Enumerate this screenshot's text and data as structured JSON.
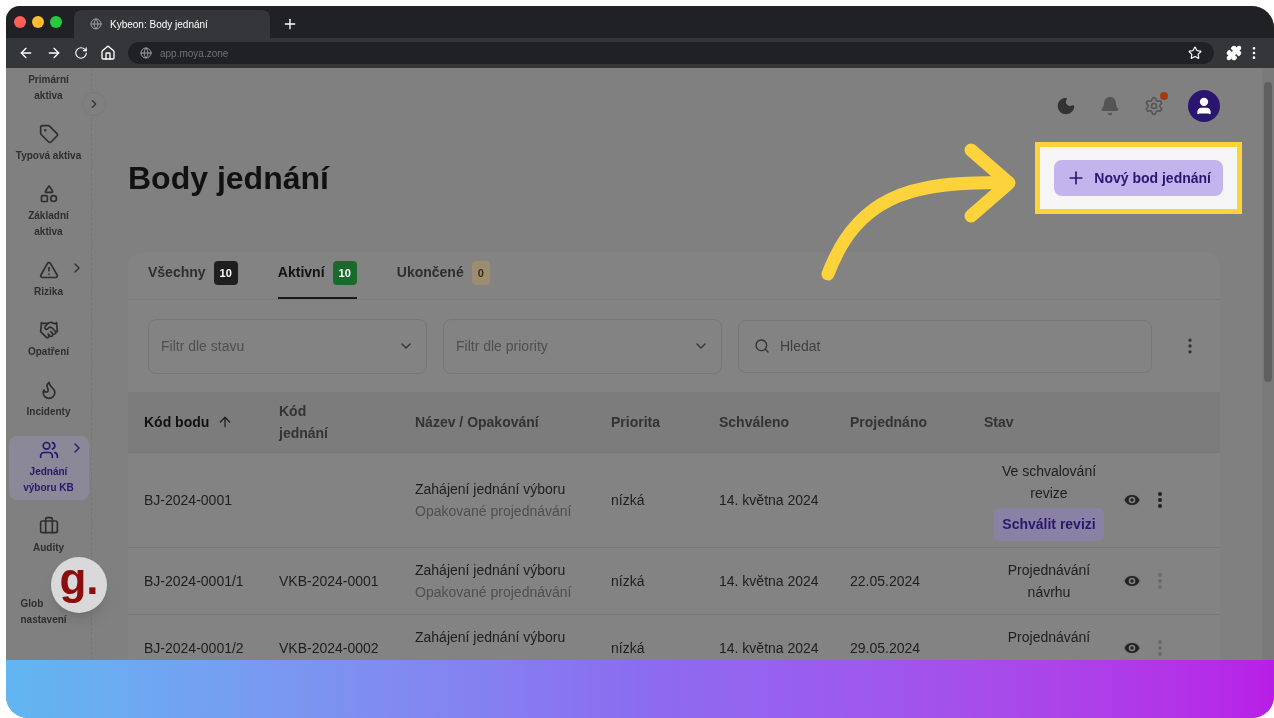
{
  "browser": {
    "tab_title": "Kybeon: Body jednání",
    "url": "app.moya.zone"
  },
  "sidebar": {
    "items": [
      {
        "kind": "none",
        "lines": [
          "Primární",
          "aktiva"
        ],
        "selected": false,
        "submenu": false
      },
      {
        "kind": "tag",
        "lines": [
          "Typová aktiva"
        ],
        "selected": false,
        "submenu": false
      },
      {
        "kind": "shapes",
        "lines": [
          "Základní",
          "aktiva"
        ],
        "selected": false,
        "submenu": false
      },
      {
        "kind": "warning",
        "lines": [
          "Rizika"
        ],
        "selected": false,
        "submenu": true
      },
      {
        "kind": "handshake",
        "lines": [
          "Opatření"
        ],
        "selected": false,
        "submenu": false
      },
      {
        "kind": "flame",
        "lines": [
          "Incidenty"
        ],
        "selected": false,
        "submenu": false
      },
      {
        "kind": "people",
        "lines": [
          "Jednání",
          "výboru KB"
        ],
        "selected": true,
        "submenu": true
      },
      {
        "kind": "briefcase",
        "lines": [
          "Audity"
        ],
        "selected": false,
        "submenu": false
      },
      {
        "kind": "none",
        "lines": [
          "Glob",
          "nastavení"
        ],
        "selected": false,
        "submenu": false
      }
    ]
  },
  "badge": {
    "text": "g."
  },
  "topbar": {
    "settings_notification": true
  },
  "page": {
    "title": "Body jednání",
    "new_button": "Nový bod jednání"
  },
  "tabs": [
    {
      "label": "Všechny",
      "count": "10",
      "color": "#1f1f1f",
      "selected": false
    },
    {
      "label": "Aktivní",
      "count": "10",
      "color": "#1a6a2c",
      "selected": true
    },
    {
      "label": "Ukončené",
      "count": "0",
      "color": "#9c8c70",
      "selected": false
    }
  ],
  "filters": [
    {
      "placeholder": "Filtr dle stavu"
    },
    {
      "placeholder": "Filtr dle priority"
    }
  ],
  "search": {
    "placeholder": "Hledat"
  },
  "table": {
    "columns": [
      {
        "label": "Kód bodu",
        "sorted": true
      },
      {
        "label": "Kód jednání",
        "sorted": false
      },
      {
        "label": "Název / Opakování",
        "sorted": false
      },
      {
        "label": "Priorita",
        "sorted": false
      },
      {
        "label": "Schváleno",
        "sorted": false
      },
      {
        "label": "Projednáno",
        "sorted": false
      },
      {
        "label": "Stav",
        "sorted": false
      }
    ],
    "rows": [
      {
        "code": "BJ-2024-0001",
        "title": "Zahájení jednání výboru",
        "subtitle": "Opakované projednávání",
        "priority": "nízká",
        "approved": "14. května 2024",
        "status": "Ve schvalování revize",
        "action": "Schválit revizi",
        "menu_disabled": false
      },
      {
        "code": "BJ-2024-0001/1",
        "meeting": "VKB-2024-0001",
        "title": "Zahájení jednání výboru",
        "subtitle": "Opakované projednávání",
        "priority": "nízká",
        "approved": "14. května 2024",
        "discussed": "22.05.2024",
        "status": "Projednávání návrhu",
        "menu_disabled": true
      },
      {
        "code": "BJ-2024-0001/2",
        "meeting": "VKB-2024-0002",
        "title": "Zahájení jednání výboru",
        "priority": "nízká",
        "approved": "14. května 2024",
        "discussed": "29.05.2024",
        "status": "Projednávání",
        "menu_disabled": true
      }
    ]
  }
}
